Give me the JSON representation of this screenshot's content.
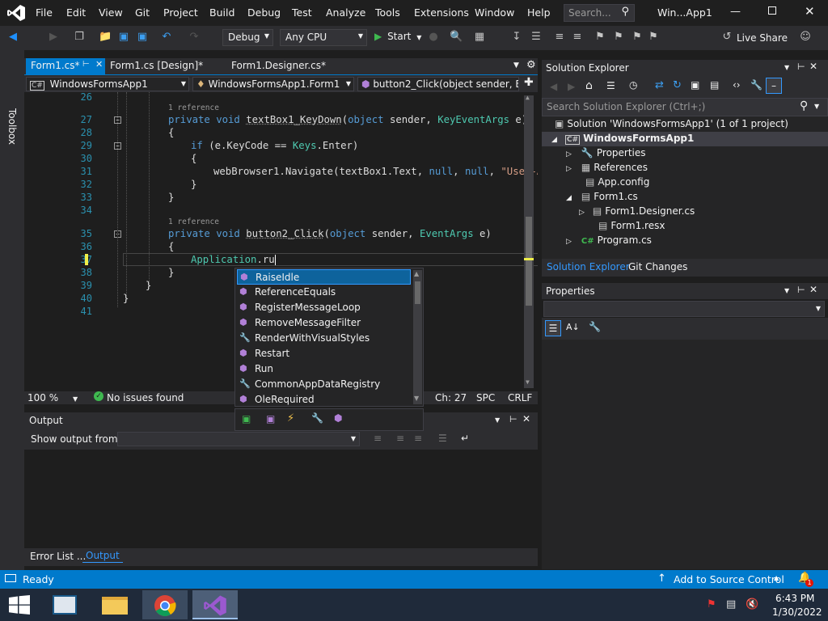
{
  "menubar": {
    "items": [
      "File",
      "Edit",
      "View",
      "Git",
      "Project",
      "Build",
      "Debug",
      "Test",
      "Analyze",
      "Tools",
      "Extensions",
      "Window",
      "Help"
    ],
    "search_placeholder": "Search...",
    "window_title": "Win...App1"
  },
  "toolbar": {
    "config": "Debug",
    "platform": "Any CPU",
    "start_label": "Start",
    "live_share": "Live Share"
  },
  "toolbox_label": "Toolbox",
  "editor": {
    "tabs": [
      "Form1.cs*",
      "Form1.cs [Design]*",
      "Form1.Designer.cs*"
    ],
    "nav": {
      "project": "WindowsFormsApp1",
      "class": "WindowsFormsApp1.Form1",
      "member": "button2_Click(object sender, Ev"
    },
    "ref_label": "1 reference",
    "line_numbers": [
      "26",
      "27",
      "28",
      "29",
      "30",
      "31",
      "32",
      "33",
      "34",
      "35",
      "36",
      "37",
      "38",
      "39",
      "40",
      "41"
    ],
    "code": {
      "l27_kw": "private void ",
      "l27_name": "textBox1_KeyDown",
      "l27_open": "(",
      "l27_kw2": "object",
      "l27_mid": " sender, ",
      "l27_type": "KeyEventArgs",
      "l27_end": " e)",
      "l28": "{",
      "l29_kw": "if",
      "l29_rest": " (e.KeyCode == ",
      "l29_type": "Keys",
      "l29_end": ".Enter)",
      "l30": "{",
      "l31_pre": "webBrowser1.Navigate(textBox1.Text, ",
      "l31_null1": "null",
      "l31_sep": ", ",
      "l31_null2": "null",
      "l31_sep2": ", ",
      "l31_str": "\"User-Agent",
      "l32": "}",
      "l33": "}",
      "l35_kw": "private void ",
      "l35_name": "button2_Click",
      "l35_open": "(",
      "l35_kw2": "object",
      "l35_mid": " sender, ",
      "l35_type": "EventArgs",
      "l35_end": " e)",
      "l36": "{",
      "l37_type": "Application",
      "l37_rest": ".ru",
      "l38": "}",
      "l39": "}",
      "l40": "}"
    },
    "status": {
      "zoom": "100 %",
      "issues": "No issues found",
      "ch": "Ch: 27",
      "spc": "SPC",
      "crlf": "CRLF"
    }
  },
  "completion": {
    "items": [
      {
        "label": "RaiseIdle",
        "icon": "method-icon"
      },
      {
        "label": "ReferenceEquals",
        "icon": "method-icon"
      },
      {
        "label": "RegisterMessageLoop",
        "icon": "method-icon"
      },
      {
        "label": "RemoveMessageFilter",
        "icon": "method-icon"
      },
      {
        "label": "RenderWithVisualStyles",
        "icon": "property-icon"
      },
      {
        "label": "Restart",
        "icon": "method-icon"
      },
      {
        "label": "Run",
        "icon": "method-icon"
      },
      {
        "label": "CommonAppDataRegistry",
        "icon": "property-icon"
      },
      {
        "label": "OleRequired",
        "icon": "method-icon"
      }
    ]
  },
  "output": {
    "title": "Output",
    "show_from": "Show output from:",
    "tabs": [
      "Error List ...",
      "Output"
    ]
  },
  "solution_explorer": {
    "title": "Solution Explorer",
    "search_placeholder": "Search Solution Explorer (Ctrl+;)",
    "solution": "Solution 'WindowsFormsApp1' (1 of 1 project)",
    "project": "WindowsFormsApp1",
    "nodes": [
      "Properties",
      "References",
      "App.config",
      "Form1.cs",
      "Form1.Designer.cs",
      "Form1.resx",
      "Program.cs"
    ],
    "tabs": [
      "Solution Explorer",
      "Git Changes"
    ]
  },
  "properties": {
    "title": "Properties"
  },
  "statusbar": {
    "ready": "Ready",
    "source_control": "Add to Source Control",
    "notifications": "1"
  },
  "taskbar": {
    "time": "6:43 PM",
    "date": "1/30/2022"
  },
  "colors": {
    "accent": "#007acc",
    "keyword": "#569cd6",
    "type": "#4ec9b0",
    "string": "#d69d85",
    "line_number": "#2b91af"
  }
}
